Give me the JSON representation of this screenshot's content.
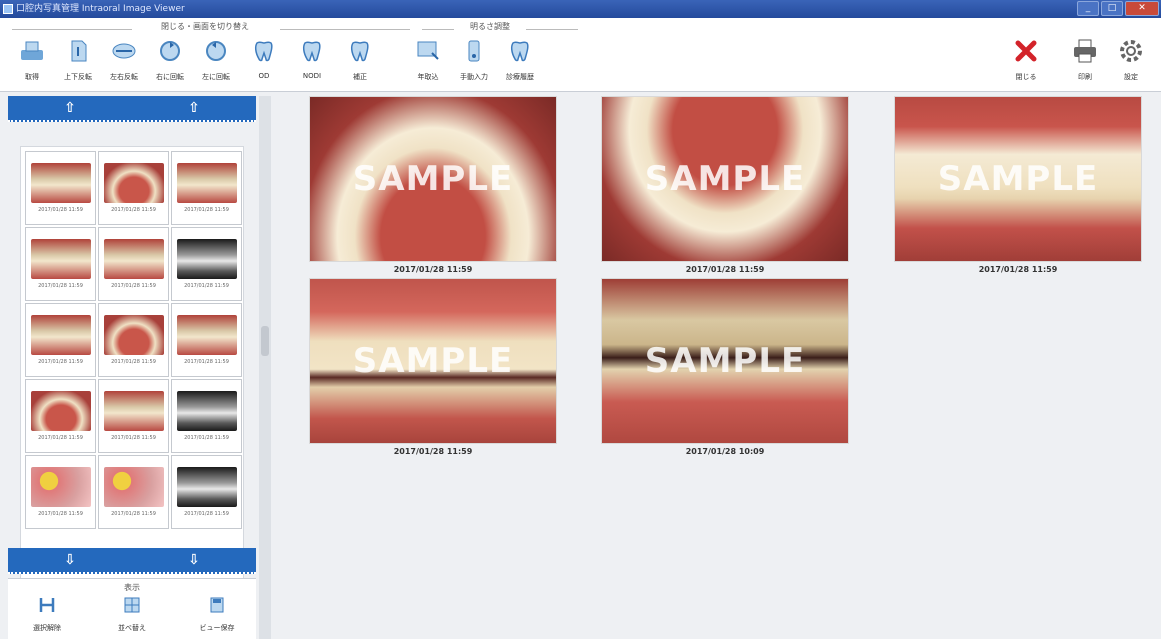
{
  "window": {
    "title": "口腔内写真管理 Intraoral Image Viewer",
    "min": "_",
    "max": "□",
    "close": "✕"
  },
  "toolbar": {
    "group1": "閉じる・画面を切り替え",
    "group2": "明るさ調整",
    "buttons": [
      {
        "label": "取得",
        "icon": "scanner-icon"
      },
      {
        "label": "上下反転",
        "icon": "flip-vertical-icon"
      },
      {
        "label": "左右反転",
        "icon": "flip-horizontal-icon"
      },
      {
        "label": "右に回転",
        "icon": "rotate-right-icon"
      },
      {
        "label": "左に回転",
        "icon": "rotate-left-icon"
      },
      {
        "label": "OD",
        "icon": "tooth-od-icon"
      },
      {
        "label": "NODI",
        "icon": "tooth-nodi-icon"
      },
      {
        "label": "補正",
        "icon": "tooth-adjust-icon"
      },
      {
        "label": "年取込",
        "icon": "import-icon"
      },
      {
        "label": "手動入力",
        "icon": "manual-input-icon"
      },
      {
        "label": "診療履歴",
        "icon": "history-icon"
      }
    ],
    "right_buttons": [
      {
        "label": "閉じる",
        "icon": "close-icon"
      },
      {
        "label": "印刷",
        "icon": "printer-icon"
      },
      {
        "label": "設定",
        "icon": "settings-icon"
      }
    ]
  },
  "left_panel": {
    "top_arrows": [
      "⇧",
      "⇧"
    ],
    "bottom_arrows": [
      "⇩",
      "⇩"
    ],
    "thumbnails": [
      {
        "kind": "teeth",
        "caption": "2017/01/28 11:59"
      },
      {
        "kind": "arch",
        "caption": "2017/01/28 11:59"
      },
      {
        "kind": "teeth",
        "caption": "2017/01/28 11:59"
      },
      {
        "kind": "teeth",
        "caption": "2017/01/28 11:59"
      },
      {
        "kind": "teeth",
        "caption": "2017/01/28 11:59"
      },
      {
        "kind": "xray",
        "caption": "2017/01/28 11:59"
      },
      {
        "kind": "teeth",
        "caption": "2017/01/28 11:59"
      },
      {
        "kind": "arch",
        "caption": "2017/01/28 11:59"
      },
      {
        "kind": "teeth",
        "caption": "2017/01/28 11:59"
      },
      {
        "kind": "arch",
        "caption": "2017/01/28 11:59"
      },
      {
        "kind": "teeth",
        "caption": "2017/01/28 11:59"
      },
      {
        "kind": "xray",
        "caption": "2017/01/28 11:59"
      },
      {
        "kind": "scope",
        "caption": "2017/01/28 11:59"
      },
      {
        "kind": "scope",
        "caption": "2017/01/28 11:59"
      },
      {
        "kind": "xray",
        "caption": "2017/01/28 11:59"
      }
    ],
    "bottom_group": "表示",
    "bottom_tools": [
      {
        "label": "選択解除",
        "icon": "deselect-icon"
      },
      {
        "label": "並べ替え",
        "icon": "grid-icon"
      },
      {
        "label": "ビュー保存",
        "icon": "save-view-icon"
      }
    ]
  },
  "main": {
    "watermark": "SAMPLE",
    "photos": [
      {
        "timestamp": "2017/01/28 11:59",
        "kind": "upper-arch"
      },
      {
        "timestamp": "2017/01/28 11:59",
        "kind": "lower-arch"
      },
      {
        "timestamp": "2017/01/28 11:59",
        "kind": "front"
      },
      {
        "timestamp": "2017/01/28 11:59",
        "kind": "right-side"
      },
      {
        "timestamp": "2017/01/28 10:09",
        "kind": "left-side"
      }
    ]
  }
}
